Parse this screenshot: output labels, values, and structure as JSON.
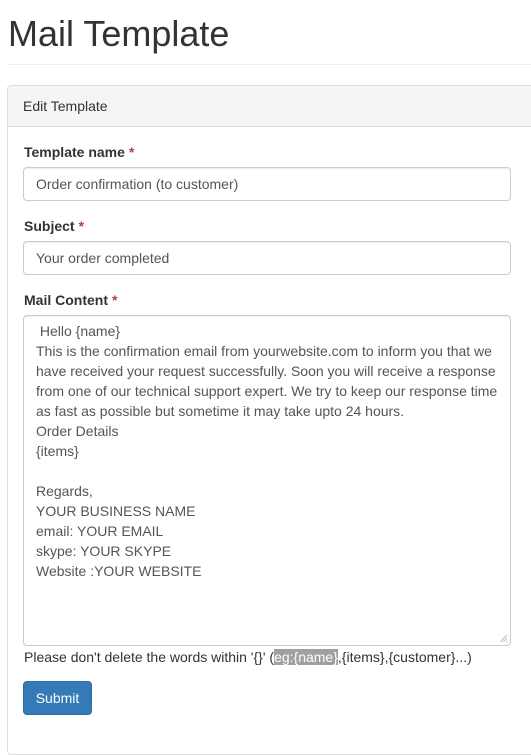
{
  "page": {
    "title": "Mail Template"
  },
  "panel": {
    "heading": "Edit Template"
  },
  "form": {
    "template_name": {
      "label": "Template name",
      "required_mark": "*",
      "value": "Order confirmation (to customer)"
    },
    "subject": {
      "label": "Subject",
      "required_mark": "*",
      "value": "Your order completed"
    },
    "mail_content": {
      "label": "Mail Content",
      "required_mark": "*",
      "value": " Hello {name}\nThis is the confirmation email from yourwebsite.com to inform you that we have received your request successfully. Soon you will receive a response from one of our technical support expert. We try to keep our response time as fast as possible but sometime it may take upto 24 hours.\nOrder Details\n{items}\n\nRegards,\nYOUR BUSINESS NAME\nemail: YOUR EMAIL\nskype: YOUR SKYPE\nWebsite :YOUR WEBSITE"
    },
    "help": {
      "prefix": "Please don't delete the words within '{}' (",
      "highlighted": "eg:{name}",
      "suffix": ",{items},{customer}...)"
    },
    "submit_label": "Submit"
  },
  "colors": {
    "primary_button": "#337ab7",
    "required_mark": "#a94442",
    "highlight_bg": "#a0a0a0"
  }
}
